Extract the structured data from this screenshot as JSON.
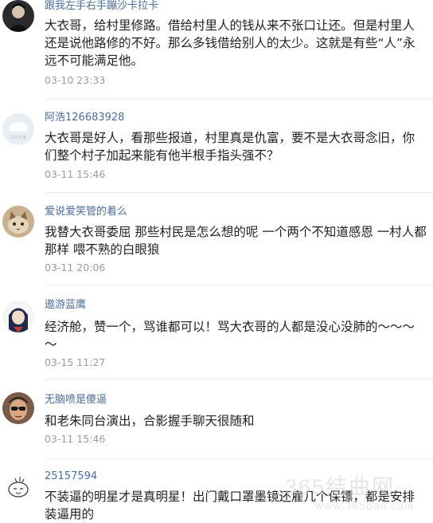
{
  "comments": [
    {
      "username": "跟我左手右手蹦沙卡拉卡",
      "content": "大衣哥，给村里修路。借给村里人的钱从来不张口让还。但是村里人还是说他路修的不好。那么多钱借给别人的太少。这就是有些“人”永远不可能满足他。",
      "time": "03-10 23:33",
      "avatar": "dark-portrait-avatar"
    },
    {
      "username": "阿浩126683928",
      "content": "大衣哥是好人，看那些报道，村里真是仇富，要不是大衣哥念旧，你们整个村子加起来能有他半根手指头强不？",
      "time": "03-11 15:46",
      "avatar": "default-cloud-avatar",
      "avatar_caption": "设定头像"
    },
    {
      "username": "爱说爱笑管的着么",
      "content": "我替大衣哥委屈 那些村民是怎么想的呢 一个两个不知道感恩 一村人都那样 喂不熟的白眼狼",
      "time": "03-11 20:06",
      "avatar": "cat-avatar"
    },
    {
      "username": "遨游蓝鹰",
      "content": "经济舱，赞一个，骂谁都可以！骂大衣哥的人都是没心没肺的～～～～",
      "time": "03-15 11:27",
      "avatar": "cartoon-girl-avatar"
    },
    {
      "username": "无脑喷是傻逼",
      "content": "和老朱同台演出，合影握手聊天很随和",
      "time": "03-11 15:46",
      "avatar": "sunglasses-man-avatar"
    },
    {
      "username": "25157594",
      "content": "不装逼的明星才是真明星！出门戴口罩墨镜还雇几个保镖，都是安排装逼用的",
      "time": "",
      "avatar": "doodle-avatar"
    }
  ],
  "watermark": {
    "text": "365结曲网",
    "url": "www.365bao.com"
  },
  "colors": {
    "username": "#4a6f9c",
    "content": "#222222",
    "time": "#9b9b9b"
  }
}
